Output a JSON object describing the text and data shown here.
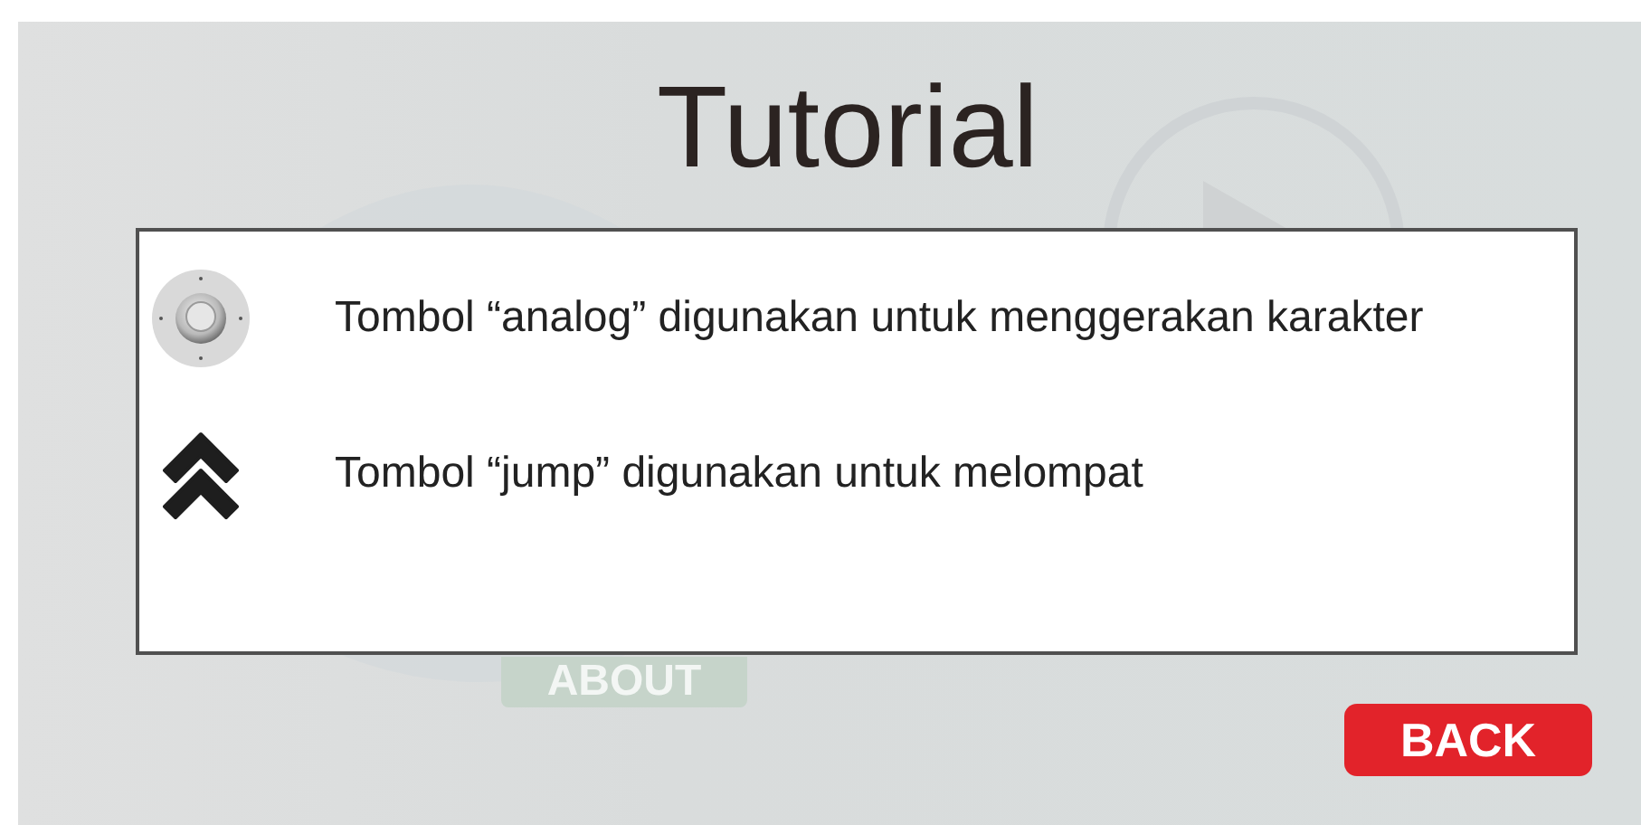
{
  "title": "Tutorial",
  "background": {
    "menu_button": "ABOUT"
  },
  "instructions": [
    {
      "kind": "analog",
      "text": "Tombol “analog” digunakan untuk menggerakan karakter"
    },
    {
      "kind": "jump",
      "text": "Tombol “jump” digunakan untuk melompat"
    }
  ],
  "back_button": "BACK"
}
